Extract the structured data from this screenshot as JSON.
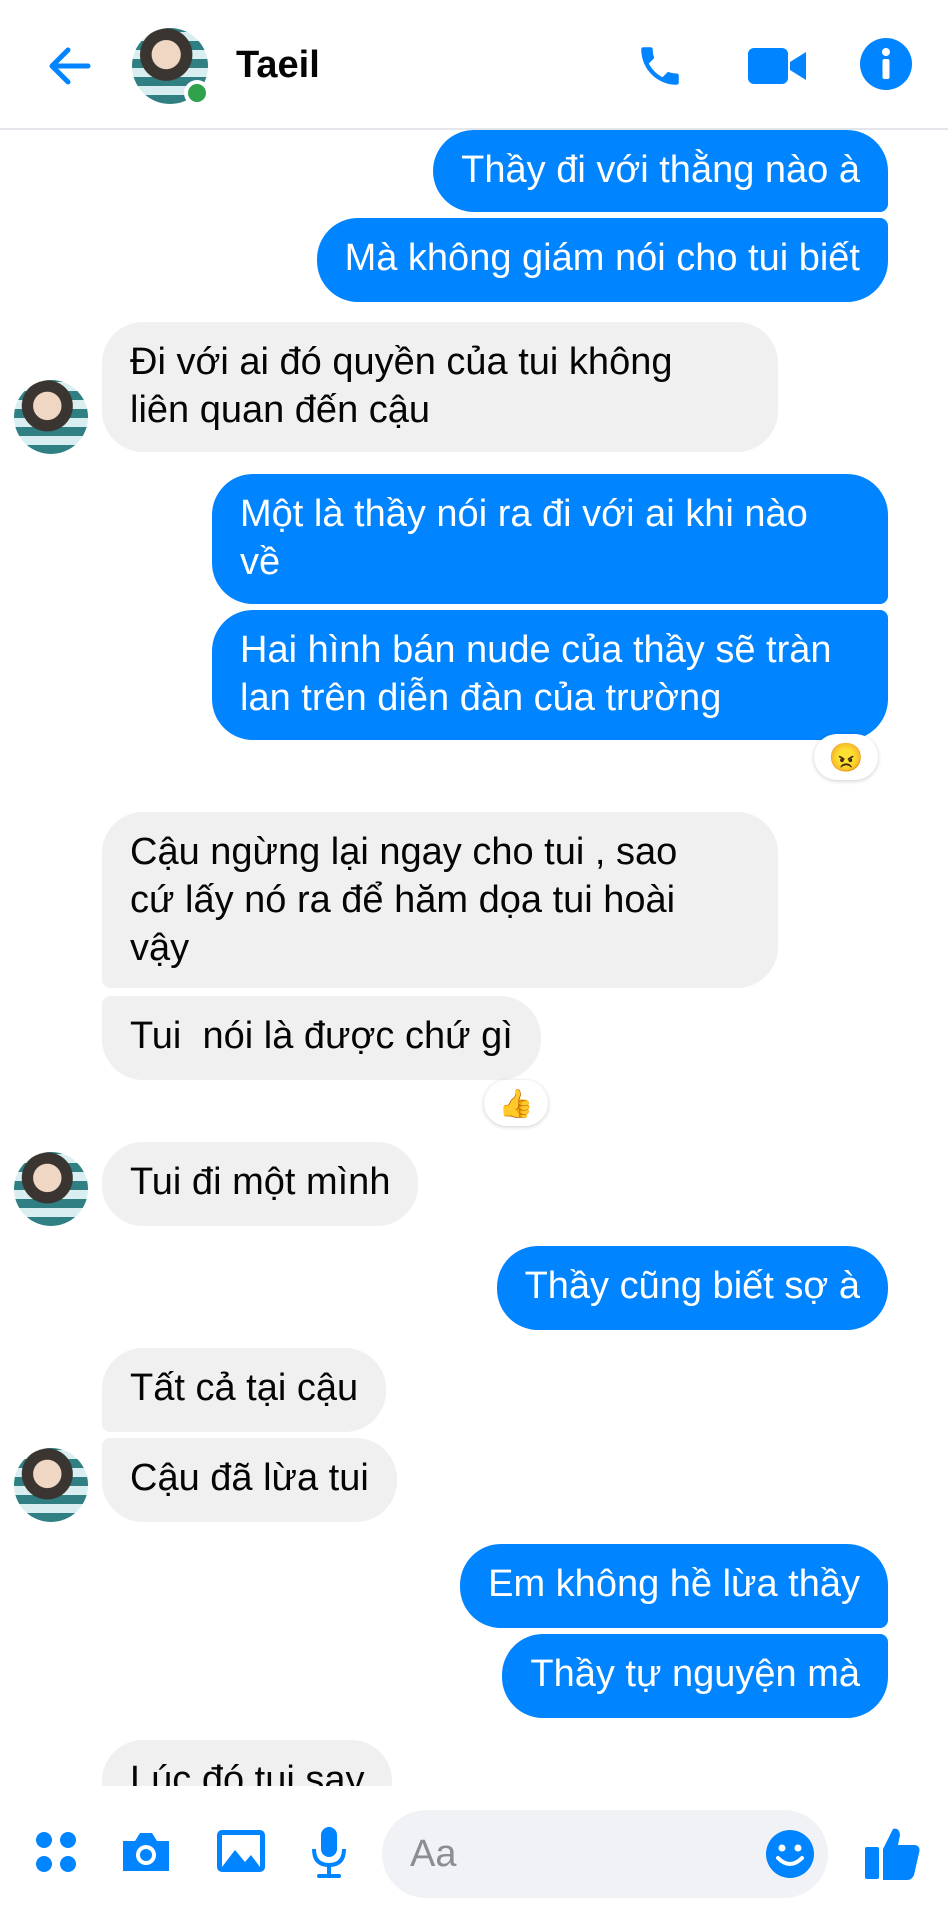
{
  "header": {
    "contact_name": "Taeil",
    "online": true,
    "accent_color": "#0084ff"
  },
  "messages": [
    {
      "side": "out",
      "text": "Thầy đi với thằng nào à"
    },
    {
      "side": "out",
      "text": "Mà không giám nói cho tui biết"
    },
    {
      "side": "in",
      "text": "Đi với ai đó quyền của tui không\nliên quan đến cậu"
    },
    {
      "side": "out",
      "text": "Một là thầy nói ra đi với ai khi nào\nvề"
    },
    {
      "side": "out",
      "text": "Hai hình bán nude của thầy sẽ tràn\nlan trên diễn đàn của trường",
      "reaction": "😠"
    },
    {
      "side": "in",
      "text": "Cậu ngừng lại ngay cho tui , sao\ncứ lấy nó ra để hăm dọa tui hoài\nvậy"
    },
    {
      "side": "in",
      "text": "Tui  nói là được chứ gì",
      "reaction": "👍"
    },
    {
      "side": "in",
      "text": "Tui đi một mình"
    },
    {
      "side": "out",
      "text": "Thầy cũng biết sợ à"
    },
    {
      "side": "in",
      "text": "Tất cả tại cậu"
    },
    {
      "side": "in",
      "text": "Cậu đã lừa tui"
    },
    {
      "side": "out",
      "text": "Em không hề lừa thầy"
    },
    {
      "side": "out",
      "text": "Thầy tự nguyện mà"
    },
    {
      "side": "in",
      "text": "Lúc đó tui say"
    }
  ],
  "composer": {
    "placeholder": "Aa"
  },
  "icons": [
    "back-arrow-icon",
    "phone-icon",
    "video-camera-icon",
    "info-icon",
    "menu-dots-icon",
    "camera-icon",
    "gallery-icon",
    "microphone-icon",
    "emoji-icon",
    "thumbs-up-icon"
  ]
}
